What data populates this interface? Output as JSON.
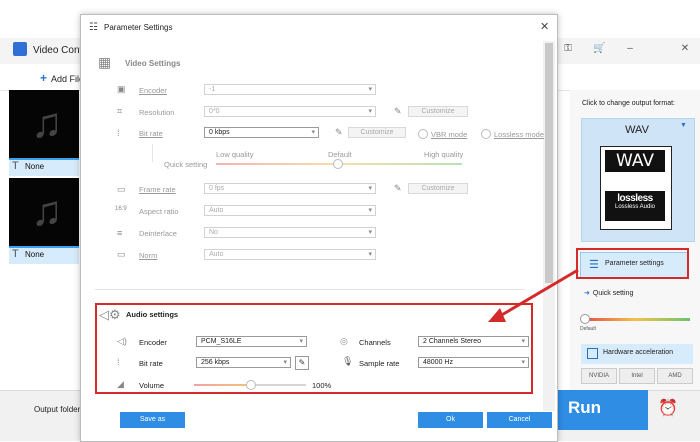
{
  "app": {
    "title": "Video Conv",
    "add_files": "Add File",
    "files": [
      {
        "subtitle": "None"
      },
      {
        "subtitle": "None"
      }
    ],
    "output_folder_label": "Output folder:",
    "run_label": "Run"
  },
  "right_panel": {
    "click_text": "Click to change output format:",
    "format_name": "WAV",
    "format_icon_big": "WAV",
    "format_icon_l1": "lossless",
    "format_icon_l2": "Lossless Audio",
    "parameter_settings": "Parameter settings",
    "quick_setting": "Quick setting",
    "default_label": "Default",
    "hardware_acceleration": "Hardware acceleration",
    "chips": [
      "NVIDIA",
      "Intel",
      "AMD"
    ]
  },
  "dialog": {
    "title": "Parameter Settings",
    "video": {
      "section_title": "Video Settings",
      "encoder_label": "Encoder",
      "encoder_value": "-1",
      "resolution_label": "Resolution",
      "resolution_value": "0*0",
      "customize_label": "Customize",
      "bitrate_label": "Bit rate",
      "bitrate_value": "0 kbps",
      "vbr_label": "VBR mode",
      "lossless_label": "Lossless mode",
      "quick_setting_label": "Quick setting",
      "low_quality": "Low quality",
      "default_quality": "Default",
      "high_quality": "High quality",
      "framerate_label": "Frame rate",
      "framerate_value": "0 fps",
      "aspect_label": "Aspect ratio",
      "aspect_value": "Auto",
      "deinterlace_label": "Deinterlace",
      "deinterlace_value": "No",
      "norm_label": "Norm",
      "norm_value": "Auto"
    },
    "audio": {
      "section_title": "Audio settings",
      "encoder_label": "Encoder",
      "encoder_value": "PCM_S16LE",
      "channels_label": "Channels",
      "channels_value": "2 Channels Stereo",
      "bitrate_label": "Bit rate",
      "bitrate_value": "256 kbps",
      "samplerate_label": "Sample rate",
      "samplerate_value": "48000 Hz",
      "volume_label": "Volume",
      "volume_value": "100%",
      "volume_level": 0.5
    },
    "save_as": "Save as",
    "ok": "Ok",
    "cancel": "Cancel"
  },
  "colors": {
    "accent": "#2f8de4",
    "highlight": "#d42a2a"
  }
}
